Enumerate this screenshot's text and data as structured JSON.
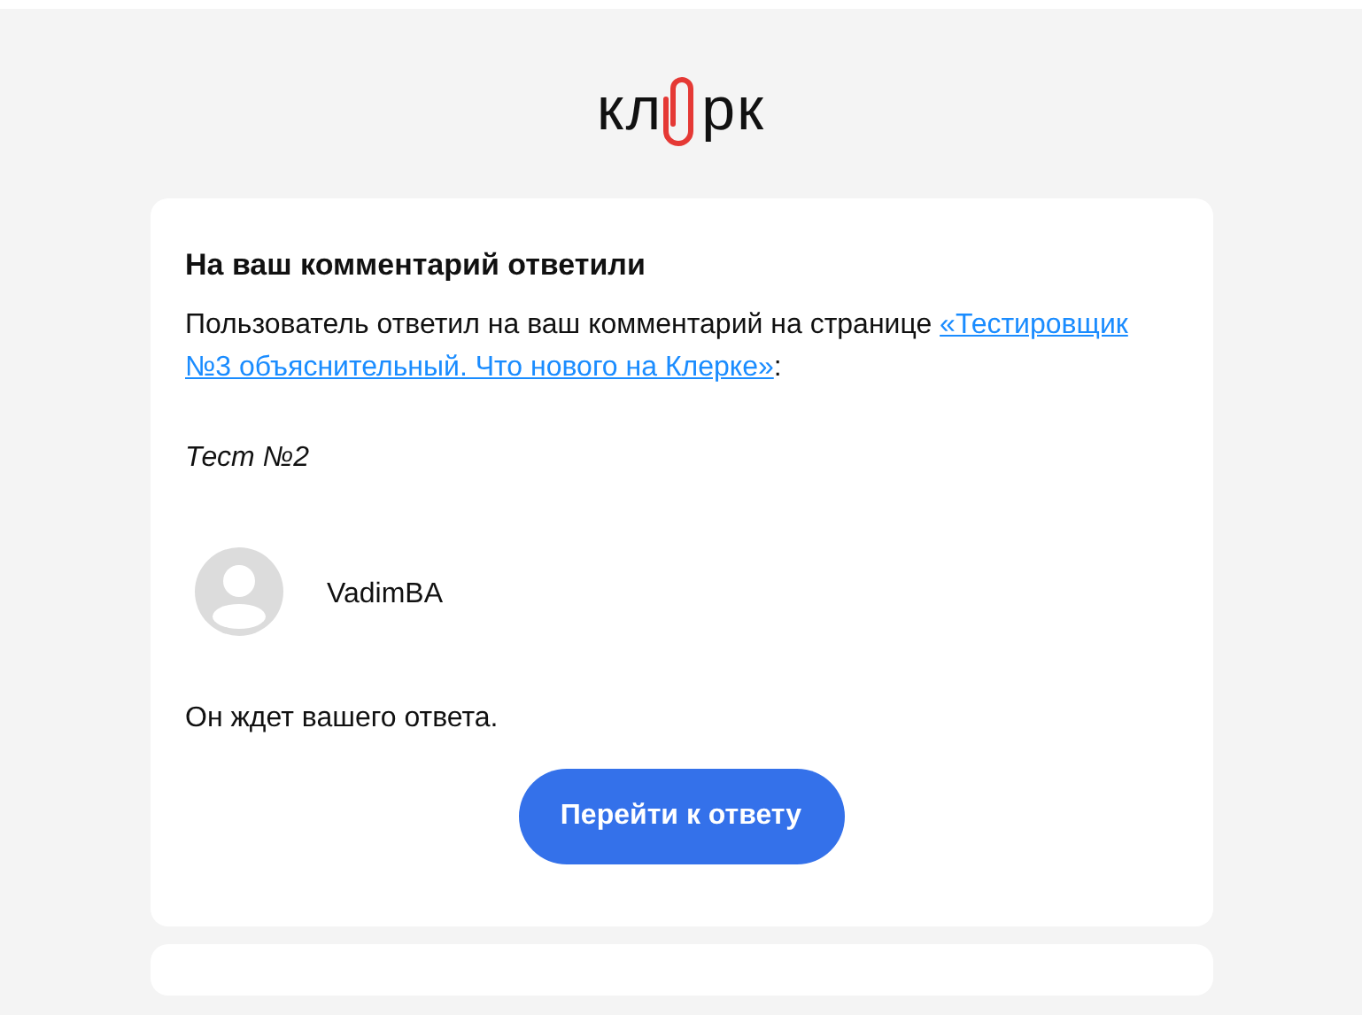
{
  "logo": {
    "left": "кл",
    "right": "рк"
  },
  "notification": {
    "title": "На ваш комментарий ответили",
    "intro": "Пользователь ответил на ваш комментарий на странице ",
    "link_lines": [
      "«Тестировщик",
      "№3 объяснительный. Что нового на Клерке»"
    ],
    "intro_end": ":",
    "comment": "Тест №2",
    "author": "VadimBA",
    "waiting": "Он ждет вашего ответа.",
    "button": "Перейти к ответу"
  }
}
